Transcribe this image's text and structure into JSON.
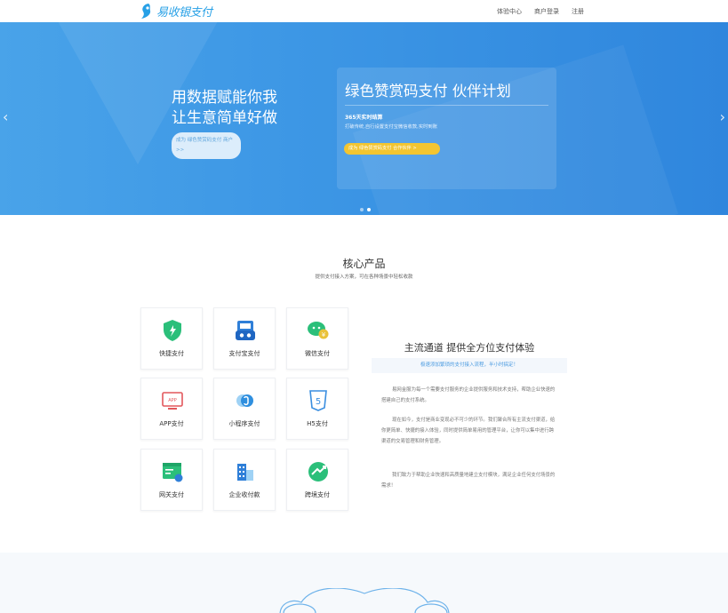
{
  "header": {
    "logo_text": "易收银支付",
    "nav": [
      "体验中心",
      "商户登录",
      "注册"
    ]
  },
  "banner": {
    "headline_line1": "用数据赋能你我",
    "headline_line2": "让生意简单好做",
    "cta_left": "成为 绿色赞赏码支付 商户 >>",
    "card": {
      "title": "绿色赞赏码支付 伙伴计划",
      "subtitle": "365天实时结算",
      "desc": "打破传统,自行设置支付宝微信收款,实时到账",
      "button": "成为 绿色赞赏码支付 合作伙伴 >"
    },
    "prev": "‹",
    "next": "›"
  },
  "core": {
    "title": "核心产品",
    "subtitle": "提供支付接入方案，可在各种场景中轻松收款",
    "tiles": [
      {
        "label": "快捷支付",
        "icon": "shield-icon"
      },
      {
        "label": "支付宝支付",
        "icon": "alipay-device-icon"
      },
      {
        "label": "微信支付",
        "icon": "wechat-icon"
      },
      {
        "label": "APP支付",
        "icon": "app-icon"
      },
      {
        "label": "小程序支付",
        "icon": "mini-program-icon"
      },
      {
        "label": "H5支付",
        "icon": "html5-icon"
      },
      {
        "label": "网关支付",
        "icon": "gateway-icon"
      },
      {
        "label": "企业收付款",
        "icon": "enterprise-icon"
      },
      {
        "label": "跨境支付",
        "icon": "cross-border-icon"
      }
    ],
    "feature": {
      "title": "主流通道 提供全方位支付体验",
      "highlight": "极速添加繁琐的支付接入流程，半小时搞定！",
      "p1": "易网金服为每一个需要支付服务的企业提供服务和技术支持，帮助企业快速的搭建自己的支付系统。",
      "p2": "现在如今，支付是商业变现必不可少的环节。我们聚合所有主流支付渠道，给你更简单、快捷的接入体验，同时提供简单易用的管理平台，让你可以集中进行跨渠道的交易管理和财务管理。",
      "p3": "我们致力于帮助企业快速和高质量地建立支付模块，满足企业任何支付场景的需求！"
    }
  },
  "colors": {
    "brand": "#27a0e6",
    "banner_start": "#49a3e9",
    "banner_end": "#2f86dd",
    "cta_yellow": "#f3c531",
    "green": "#2bbf7a"
  }
}
